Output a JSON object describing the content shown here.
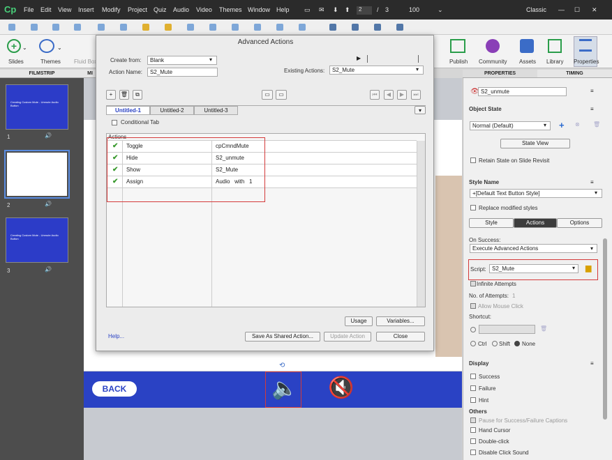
{
  "app": {
    "logo": "Cp",
    "menus": [
      "File",
      "Edit",
      "View",
      "Insert",
      "Modify",
      "Project",
      "Quiz",
      "Audio",
      "Video",
      "Themes",
      "Window",
      "Help"
    ],
    "slide_current": "2",
    "slide_sep": "/",
    "slide_total": "3",
    "zoom": "100",
    "workspace": "Classic"
  },
  "toolbar": {
    "slides": "Slides",
    "themes": "Themes",
    "fluid": "Fluid Box",
    "publish": "Publish",
    "community": "Community",
    "assets": "Assets",
    "library": "Library",
    "properties": "Properties"
  },
  "panels": {
    "filmstrip": "FILMSTRIP",
    "mi": "MI",
    "properties": "PROPERTIES",
    "timing": "TIMING"
  },
  "filmstrip": {
    "thumbs": [
      {
        "num": "1",
        "t1": "Creating Custom Mute - Unmute Audio Button"
      },
      {
        "num": "2",
        "t1": ""
      },
      {
        "num": "3",
        "t1": "Creating Custom Mute - Unmute Audio Button"
      }
    ]
  },
  "dialog": {
    "title": "Advanced Actions",
    "create_from_label": "Create from:",
    "create_from": "Blank",
    "action_name_label": "Action Name:",
    "action_name": "S2_Mute",
    "existing_label": "Existing Actions:",
    "existing": "S2_Mute",
    "tabs": [
      "Untitled-1",
      "Untitled-2",
      "Untitled-3"
    ],
    "conditional_tab": "Conditional Tab",
    "actions_label": "Actions",
    "rows": [
      {
        "action": "Toggle",
        "target": "cpCmndMute"
      },
      {
        "action": "Hide",
        "target": "S2_unmute"
      },
      {
        "action": "Show",
        "target": "S2_Mute"
      },
      {
        "action": "Assign",
        "target": "Audio   with   1"
      }
    ],
    "usage": "Usage",
    "variables": "Variables...",
    "help": "Help...",
    "save_shared": "Save As Shared Action...",
    "update": "Update Action",
    "close": "Close"
  },
  "stage": {
    "back": "BACK"
  },
  "props": {
    "name": "S2_unmute",
    "object_state": "Object State",
    "state": "Normal (Default)",
    "state_view": "State View",
    "retain": "Retain State on Slide Revisit",
    "style_name": "Style Name",
    "style": "+[Default Text Button Style]",
    "replace": "Replace modified styles",
    "tabs": [
      "Style",
      "Actions",
      "Options"
    ],
    "on_success": "On Success:",
    "on_success_val": "Execute Advanced Actions",
    "script_label": "Script:",
    "script": "S2_Mute",
    "infinite": "Infinite Attempts",
    "attempts_label": "No. of Attempts:",
    "attempts": "1",
    "allow_mouse": "Allow Mouse Click",
    "shortcut": "Shortcut:",
    "ctrl": "Ctrl",
    "shift": "Shift",
    "none": "None",
    "display": "Display",
    "success": "Success",
    "failure": "Failure",
    "hint": "Hint",
    "others": "Others",
    "pause": "Pause for Success/Failure Captions",
    "hand": "Hand Cursor",
    "dbl": "Double-click",
    "disable_click": "Disable Click Sound"
  },
  "colors": {
    "accent": "#2a42c4",
    "highlight": "#d43a3a",
    "check": "#3a9a2f"
  }
}
